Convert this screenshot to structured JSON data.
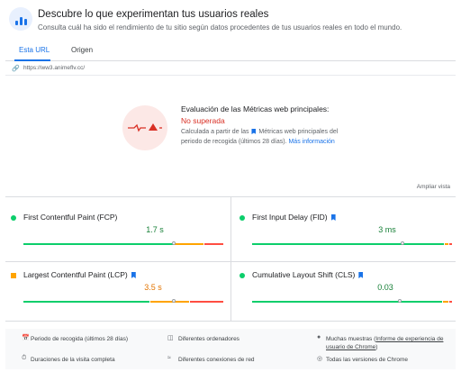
{
  "header": {
    "title": "Descubre lo que experimentan tus usuarios reales",
    "subtitle": "Consulta cuál ha sido el rendimiento de tu sitio según datos procedentes de tus usuarios reales en todo el mundo."
  },
  "tabs": [
    {
      "label": "Esta URL",
      "active": true
    },
    {
      "label": "Origen",
      "active": false
    }
  ],
  "url": "https://ww3.animeflv.cc/",
  "assessment": {
    "title": "Evaluación de las Métricas web principales:",
    "status": "No superada",
    "desc_before": "Calculada a partir de las",
    "desc_after": "Métricas web principales del periodo de recogida (últimos 28 días).",
    "more_link": "Más información"
  },
  "expand_label": "Ampliar vista",
  "metrics": [
    {
      "name": "First Contentful Paint (FCP)",
      "value": "1.7 s",
      "status_color": "#0cce6b",
      "value_color": "#188038",
      "flag": false,
      "marker_fraction": 0.75,
      "segments": [
        0.75,
        0.15,
        0.1
      ]
    },
    {
      "name": "First Input Delay (FID)",
      "value": "3 ms",
      "status_color": "#0cce6b",
      "value_color": "#188038",
      "flag": true,
      "marker_fraction": 0.75,
      "segments": [
        0.96,
        0.02,
        0.02
      ]
    },
    {
      "name": "Largest Contentful Paint (LCP)",
      "value": "3.5 s",
      "status_color": "#ffa400",
      "value_color": "#e37400",
      "flag": true,
      "marker_fraction": 0.75,
      "segments": [
        0.63,
        0.2,
        0.17
      ]
    },
    {
      "name": "Cumulative Layout Shift (CLS)",
      "value": "0.03",
      "status_color": "#0cce6b",
      "value_color": "#188038",
      "flag": true,
      "marker_fraction": 0.74,
      "segments": [
        0.95,
        0.03,
        0.02
      ]
    }
  ],
  "bar_colors": {
    "good": "#0cce6b",
    "needs_improvement": "#ffa400",
    "poor": "#ff4e42"
  },
  "footer": {
    "collection_period": "Periodo de recogida (últimos 28 días)",
    "devices": "Diferentes ordenadores",
    "samples_prefix": "Muchas muestras (",
    "samples_link": "Informe de experiencia de usuario de Chrome",
    "samples_suffix": ")",
    "visit_durations": "Duraciones de la visita completa",
    "network": "Diferentes conexiones de red",
    "chrome_versions": "Todas las versiones de Chrome"
  }
}
